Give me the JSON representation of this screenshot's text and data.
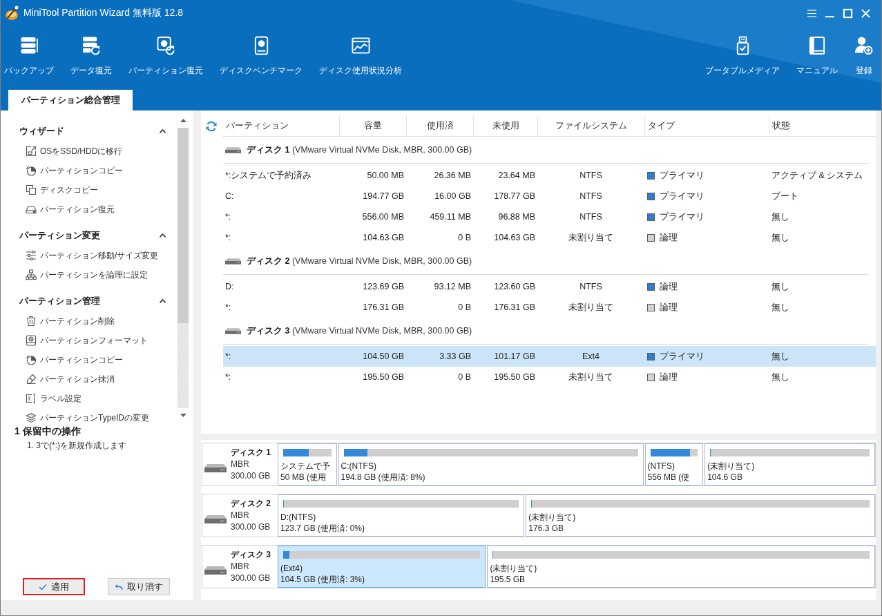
{
  "window": {
    "title": "MiniTool Partition Wizard 無料版 12.8"
  },
  "toolbar": {
    "left": [
      {
        "label": "バックアップ"
      },
      {
        "label": "データ復元"
      },
      {
        "label": "パーティション復元"
      },
      {
        "label": "ディスクベンチマーク"
      },
      {
        "label": "ディスク使用状況分析"
      }
    ],
    "right": [
      {
        "label": "ブータブルメディア"
      },
      {
        "label": "マニュアル"
      },
      {
        "label": "登録"
      }
    ]
  },
  "tabs": [
    {
      "label": "パーティション総合管理",
      "selected": true
    }
  ],
  "sidebar": {
    "sections": [
      {
        "title": "ウィザード",
        "expanded": true,
        "items": [
          "OSをSSD/HDDに移行",
          "パーティションコピー",
          "ディスクコピー",
          "パーティション復元"
        ]
      },
      {
        "title": "パーティション変更",
        "expanded": true,
        "items": [
          "パーティション移動/サイズ変更",
          "パーティションを論理に設定"
        ]
      },
      {
        "title": "パーティション管理",
        "expanded": true,
        "items": [
          "パーティション削除",
          "パーティションフォーマット",
          "パーティションコピー",
          "パーティション抹消",
          "ラベル設定",
          "パーティションTypeIDの変更"
        ]
      }
    ]
  },
  "pending_operations": {
    "title": "1 保留中の操作",
    "items": [
      "1. 3で(*:)を新規作成します"
    ]
  },
  "actions": [
    {
      "kind": "apply",
      "label": "適用",
      "highlighted": true
    },
    {
      "kind": "undo",
      "label": "取り消す",
      "highlighted": false
    }
  ],
  "table": {
    "columns": [
      "パーティション",
      "容量",
      "使用済",
      "未使用",
      "ファイルシステム",
      "タイプ",
      "状態"
    ],
    "disks": [
      {
        "label": "**ディスク 1** (VMware Virtual NVMe Disk, MBR, 300.00 GB)",
        "partitions": [
          {
            "partition": "*:システムで予約済み",
            "capacity": "50.00 MB",
            "used": "26.36 MB",
            "unused": "23.64 MB",
            "file_system": "NTFS",
            "type": "プライマリ",
            "color": "#2b7fd3",
            "status": "アクティブ & システム",
            "selected": false
          },
          {
            "partition": "C:",
            "capacity": "194.77 GB",
            "used": "16.00 GB",
            "unused": "178.77 GB",
            "file_system": "NTFS",
            "type": "プライマリ",
            "color": "#2b7fd3",
            "status": "ブート",
            "selected": false
          },
          {
            "partition": "*:",
            "capacity": "556.00 MB",
            "used": "459.11 MB",
            "unused": "96.88 MB",
            "file_system": "NTFS",
            "type": "プライマリ",
            "color": "#2b7fd3",
            "status": "無し",
            "selected": false
          },
          {
            "partition": "*:",
            "capacity": "104.63 GB",
            "used": "0 B",
            "unused": "104.63 GB",
            "file_system": "未割り当て",
            "type": "論理",
            "color": "#d2d2d2",
            "status": "無し",
            "selected": false
          }
        ]
      },
      {
        "label": "**ディスク 2** (VMware Virtual NVMe Disk, MBR, 300.00 GB)",
        "partitions": [
          {
            "partition": "D:",
            "capacity": "123.69 GB",
            "used": "93.12 MB",
            "unused": "123.60 GB",
            "file_system": "NTFS",
            "type": "論理",
            "color": "#2b7fd3",
            "status": "無し",
            "selected": false
          },
          {
            "partition": "*:",
            "capacity": "176.31 GB",
            "used": "0 B",
            "unused": "176.31 GB",
            "file_system": "未割り当て",
            "type": "論理",
            "color": "#d2d2d2",
            "status": "無し",
            "selected": false
          }
        ]
      },
      {
        "label": "**ディスク 3** (VMware Virtual NVMe Disk, MBR, 300.00 GB)",
        "partitions": [
          {
            "partition": "*:",
            "capacity": "104.50 GB",
            "used": "3.33 GB",
            "unused": "101.17 GB",
            "file_system": "Ext4",
            "type": "プライマリ",
            "color": "#2b7fd3",
            "status": "無し",
            "selected": true
          },
          {
            "partition": "*:",
            "capacity": "195.50 GB",
            "used": "0 B",
            "unused": "195.50 GB",
            "file_system": "未割り当て",
            "type": "論理",
            "color": "#d2d2d2",
            "status": "無し",
            "selected": false
          }
        ]
      }
    ]
  },
  "disk_map": {
    "disks": [
      {
        "name": "ディスク 1",
        "scheme": "MBR",
        "size": "300.00 GB",
        "partitions": [
          {
            "label": "システムで予",
            "detail": "50 MB (使用",
            "level": 0.53,
            "selected": false
          },
          {
            "label": "C:(NTFS)",
            "detail": "194.8 GB (使用済: 8%)",
            "level": 0.08,
            "selected": false
          },
          {
            "label": "(NTFS)",
            "detail": "556 MB (使",
            "level": 0.83,
            "selected": false
          },
          {
            "label": "(未割り当て)",
            "detail": "104.6 GB",
            "level": 0,
            "selected": false
          }
        ]
      },
      {
        "name": "ディスク 2",
        "scheme": "MBR",
        "size": "300.00 GB",
        "partitions": [
          {
            "label": "D:(NTFS)",
            "detail": "123.7 GB (使用済: 0%)",
            "level": 0,
            "selected": false
          },
          {
            "label": "(未割り当て)",
            "detail": "176.3 GB",
            "level": 0,
            "selected": false
          }
        ]
      },
      {
        "name": "ディスク 3",
        "scheme": "MBR",
        "size": "300.00 GB",
        "partitions": [
          {
            "label": "(Ext4)",
            "detail": "104.5 GB (使用済: 3%)",
            "level": 0.03,
            "selected": true
          },
          {
            "label": "(未割り当て)",
            "detail": "195.5 GB",
            "level": 0,
            "selected": false
          }
        ]
      }
    ]
  }
}
